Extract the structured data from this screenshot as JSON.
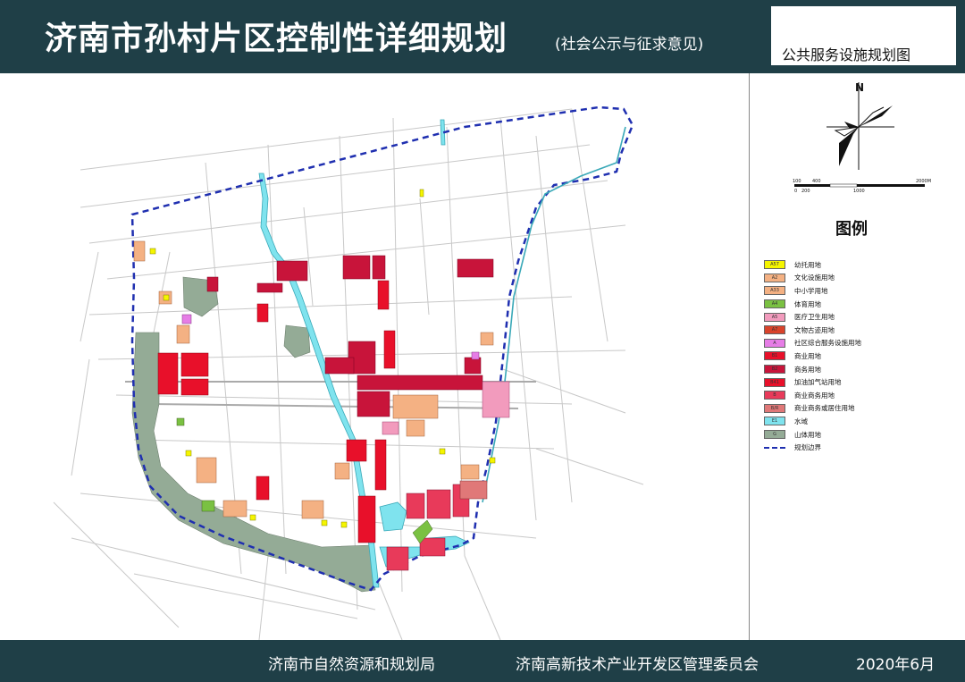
{
  "header": {
    "title": "济南市孙村片区控制性详细规划",
    "subtitle": "(社会公示与征求意见)",
    "map_name": "公共服务设施规划图"
  },
  "legend": {
    "title": "图例",
    "north": "N",
    "scale_labels": [
      "100",
      "400",
      "1000",
      "2000M",
      "0",
      "200"
    ],
    "items": [
      {
        "code": "A57",
        "label": "幼托用地",
        "color": "#f5f500"
      },
      {
        "code": "A2",
        "label": "文化设施用地",
        "color": "#f4b183"
      },
      {
        "code": "A33",
        "label": "中小学用地",
        "color": "#f4b183"
      },
      {
        "code": "A4",
        "label": "体育用地",
        "color": "#7ac142"
      },
      {
        "code": "A5",
        "label": "医疗卫生用地",
        "color": "#f29bbd"
      },
      {
        "code": "A7",
        "label": "文物古迹用地",
        "color": "#d9432b"
      },
      {
        "code": "A",
        "label": "社区综合服务设施用地",
        "color": "#e67de6"
      },
      {
        "code": "B1",
        "label": "商业用地",
        "color": "#e8102a"
      },
      {
        "code": "B2",
        "label": "商务用地",
        "color": "#c8143a"
      },
      {
        "code": "B41",
        "label": "加油加气站用地",
        "color": "#e8102a"
      },
      {
        "code": "B",
        "label": "商业商务用地",
        "color": "#e83a5a"
      },
      {
        "code": "B/R",
        "label": "商业商务或居住用地",
        "color": "#e07878"
      },
      {
        "code": "E1",
        "label": "水域",
        "color": "#7fe3ee"
      },
      {
        "code": "G",
        "label": "山体用地",
        "color": "#94ab96"
      },
      {
        "code": "",
        "label": "规划边界",
        "color": "#1f2fb0",
        "dashed": true
      }
    ]
  },
  "footer": {
    "left": "济南市自然资源和规划局",
    "middle": "济南高新技术产业开发区管理委员会",
    "date": "2020年6月"
  },
  "colors": {
    "band": "#1f3f47",
    "boundary": "#1f2fb0",
    "water": "#7fe3ee",
    "mountain": "#94ab96"
  }
}
